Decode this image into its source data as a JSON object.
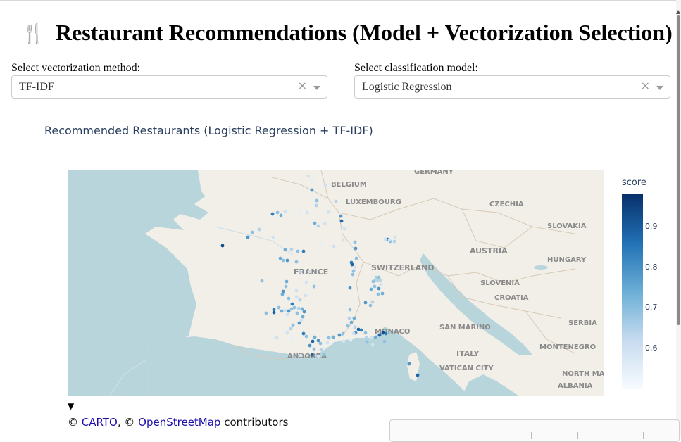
{
  "header": {
    "icon": "fork-and-knife-icon",
    "icon_glyph": "🍴",
    "title": "Restaurant Recommendations (Model + Vectorization Selection)"
  },
  "controls": {
    "vectorization": {
      "label": "Select vectorization method:",
      "value": "TF-IDF",
      "clear_glyph": "×"
    },
    "classification": {
      "label": "Select classification model:",
      "value": "Logistic Regression",
      "clear_glyph": "×"
    }
  },
  "chart": {
    "title": "Recommended Restaurants (Logistic Regression + TF-IDF)",
    "colorbar_title": "score",
    "colorbar_ticks": [
      "0.9",
      "0.8",
      "0.7",
      "0.6"
    ],
    "colorscale": [
      "#08306b",
      "#2171b5",
      "#6baed6",
      "#c6dbef",
      "#f7fbff"
    ]
  },
  "map_labels": [
    "GERMANY",
    "BELGIUM",
    "LUXEMBOURG",
    "CZECHIA",
    "SLOVAKIA",
    "FRANCE",
    "SWITZERLAND",
    "AUSTRIA",
    "HUNGARY",
    "SLOVENIA",
    "CROATIA",
    "SERBIA",
    "SAN MARINO",
    "MONACO",
    "ITALY",
    "MONTENEGRO",
    "ANDORRA",
    "VATICAN CITY",
    "NORTH MAC",
    "ALBANIA"
  ],
  "footer": {
    "toggle_glyph": "▼",
    "copyright": "©",
    "carto_link": "CARTO",
    "separator": ", ©",
    "osm_link": "OpenStreetMap",
    "contributors": "contributors"
  }
}
